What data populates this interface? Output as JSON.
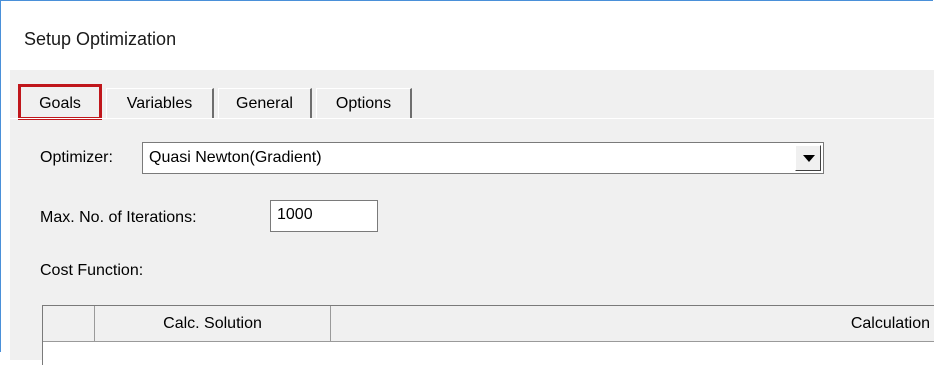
{
  "window": {
    "title": "Setup Optimization"
  },
  "tabs": [
    {
      "label": "Goals",
      "active": true
    },
    {
      "label": "Variables",
      "active": false
    },
    {
      "label": "General",
      "active": false
    },
    {
      "label": "Options",
      "active": false
    }
  ],
  "optimizer": {
    "label": "Optimizer:",
    "value": "Quasi Newton(Gradient)"
  },
  "iterations": {
    "label": "Max. No. of Iterations:",
    "value": "1000"
  },
  "cost_function": {
    "label": "Cost Function:",
    "columns": [
      "",
      "Calc. Solution",
      "Calculation"
    ]
  },
  "colors": {
    "highlight": "#c0161b",
    "window_border": "#4a90d9",
    "panel_bg": "#f0f0f0"
  },
  "icons": {
    "dropdown": "chevron-down-icon"
  }
}
